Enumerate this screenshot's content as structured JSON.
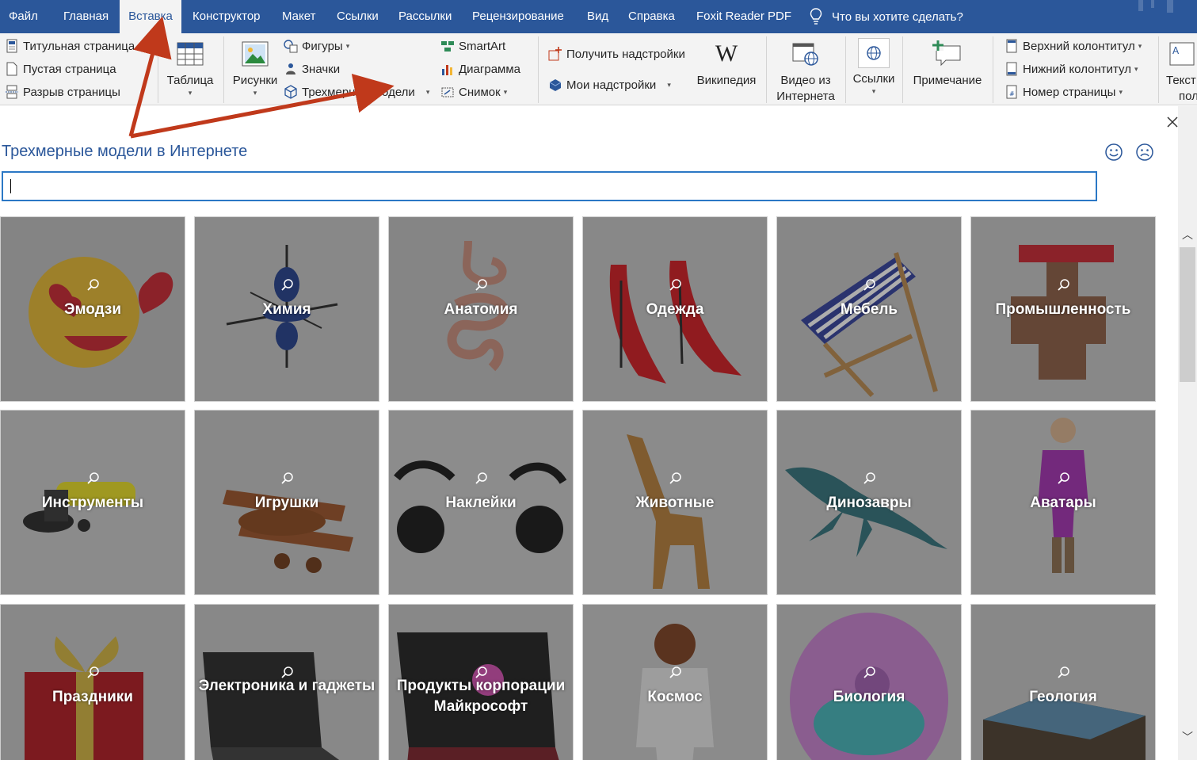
{
  "tabs": [
    "Файл",
    "Главная",
    "Вставка",
    "Конструктор",
    "Макет",
    "Ссылки",
    "Рассылки",
    "Рецензирование",
    "Вид",
    "Справка",
    "Foxit Reader PDF"
  ],
  "active_tab": "Вставка",
  "tell_me": "Что вы хотите сделать?",
  "ribbon": {
    "cover_page": "Титульная страница",
    "blank_page": "Пустая страница",
    "page_break": "Разрыв страницы",
    "table": "Таблица",
    "pictures": "Рисунки",
    "shapes": "Фигуры",
    "icons": "Значки",
    "models_3d": "Трехмерные модели",
    "smartart": "SmartArt",
    "chart": "Диаграмма",
    "screenshot": "Снимок",
    "get_addins": "Получить надстройки",
    "my_addins": "Мои надстройки",
    "wikipedia": "Википедия",
    "online_video_l1": "Видео из",
    "online_video_l2": "Интернета",
    "links": "Ссылки",
    "comment": "Примечание",
    "header": "Верхний колонтитул",
    "footer": "Нижний колонтитул",
    "page_number": "Номер страницы",
    "text_l1": "Текст",
    "text_l2": "пол"
  },
  "panel": {
    "title": "Трехмерные модели в Интернете",
    "search_value": ""
  },
  "categories": [
    {
      "label": "Эмодзи",
      "icon": "emoji-face"
    },
    {
      "label": "Химия",
      "icon": "orbital-model"
    },
    {
      "label": "Анатомия",
      "icon": "digestive-system"
    },
    {
      "label": "Одежда",
      "icon": "red-heels"
    },
    {
      "label": "Мебель",
      "icon": "deck-chair"
    },
    {
      "label": "Промышленность",
      "icon": "pipe-valve"
    },
    {
      "label": "Инструменты",
      "icon": "angle-grinder"
    },
    {
      "label": "Игрушки",
      "icon": "toy-biplane"
    },
    {
      "label": "Наклейки",
      "icon": "cartoon-eyes"
    },
    {
      "label": "Животные",
      "icon": "giraffe"
    },
    {
      "label": "Динозавры",
      "icon": "plesiosaur"
    },
    {
      "label": "Аватары",
      "icon": "avatar-girl"
    },
    {
      "label": "Праздники",
      "icon": "gift-box"
    },
    {
      "label": "Электроника и гаджеты",
      "icon": "laptop"
    },
    {
      "label": "Продукты корпорации Майкрософт",
      "icon": "surface-tablet"
    },
    {
      "label": "Космос",
      "icon": "astronaut"
    },
    {
      "label": "Биология",
      "icon": "cell"
    },
    {
      "label": "Геология",
      "icon": "terrain-block"
    }
  ],
  "colors": {
    "accent": "#2b579a",
    "annotation_arrow": "#c0391b",
    "search_border": "#2b78c5"
  }
}
